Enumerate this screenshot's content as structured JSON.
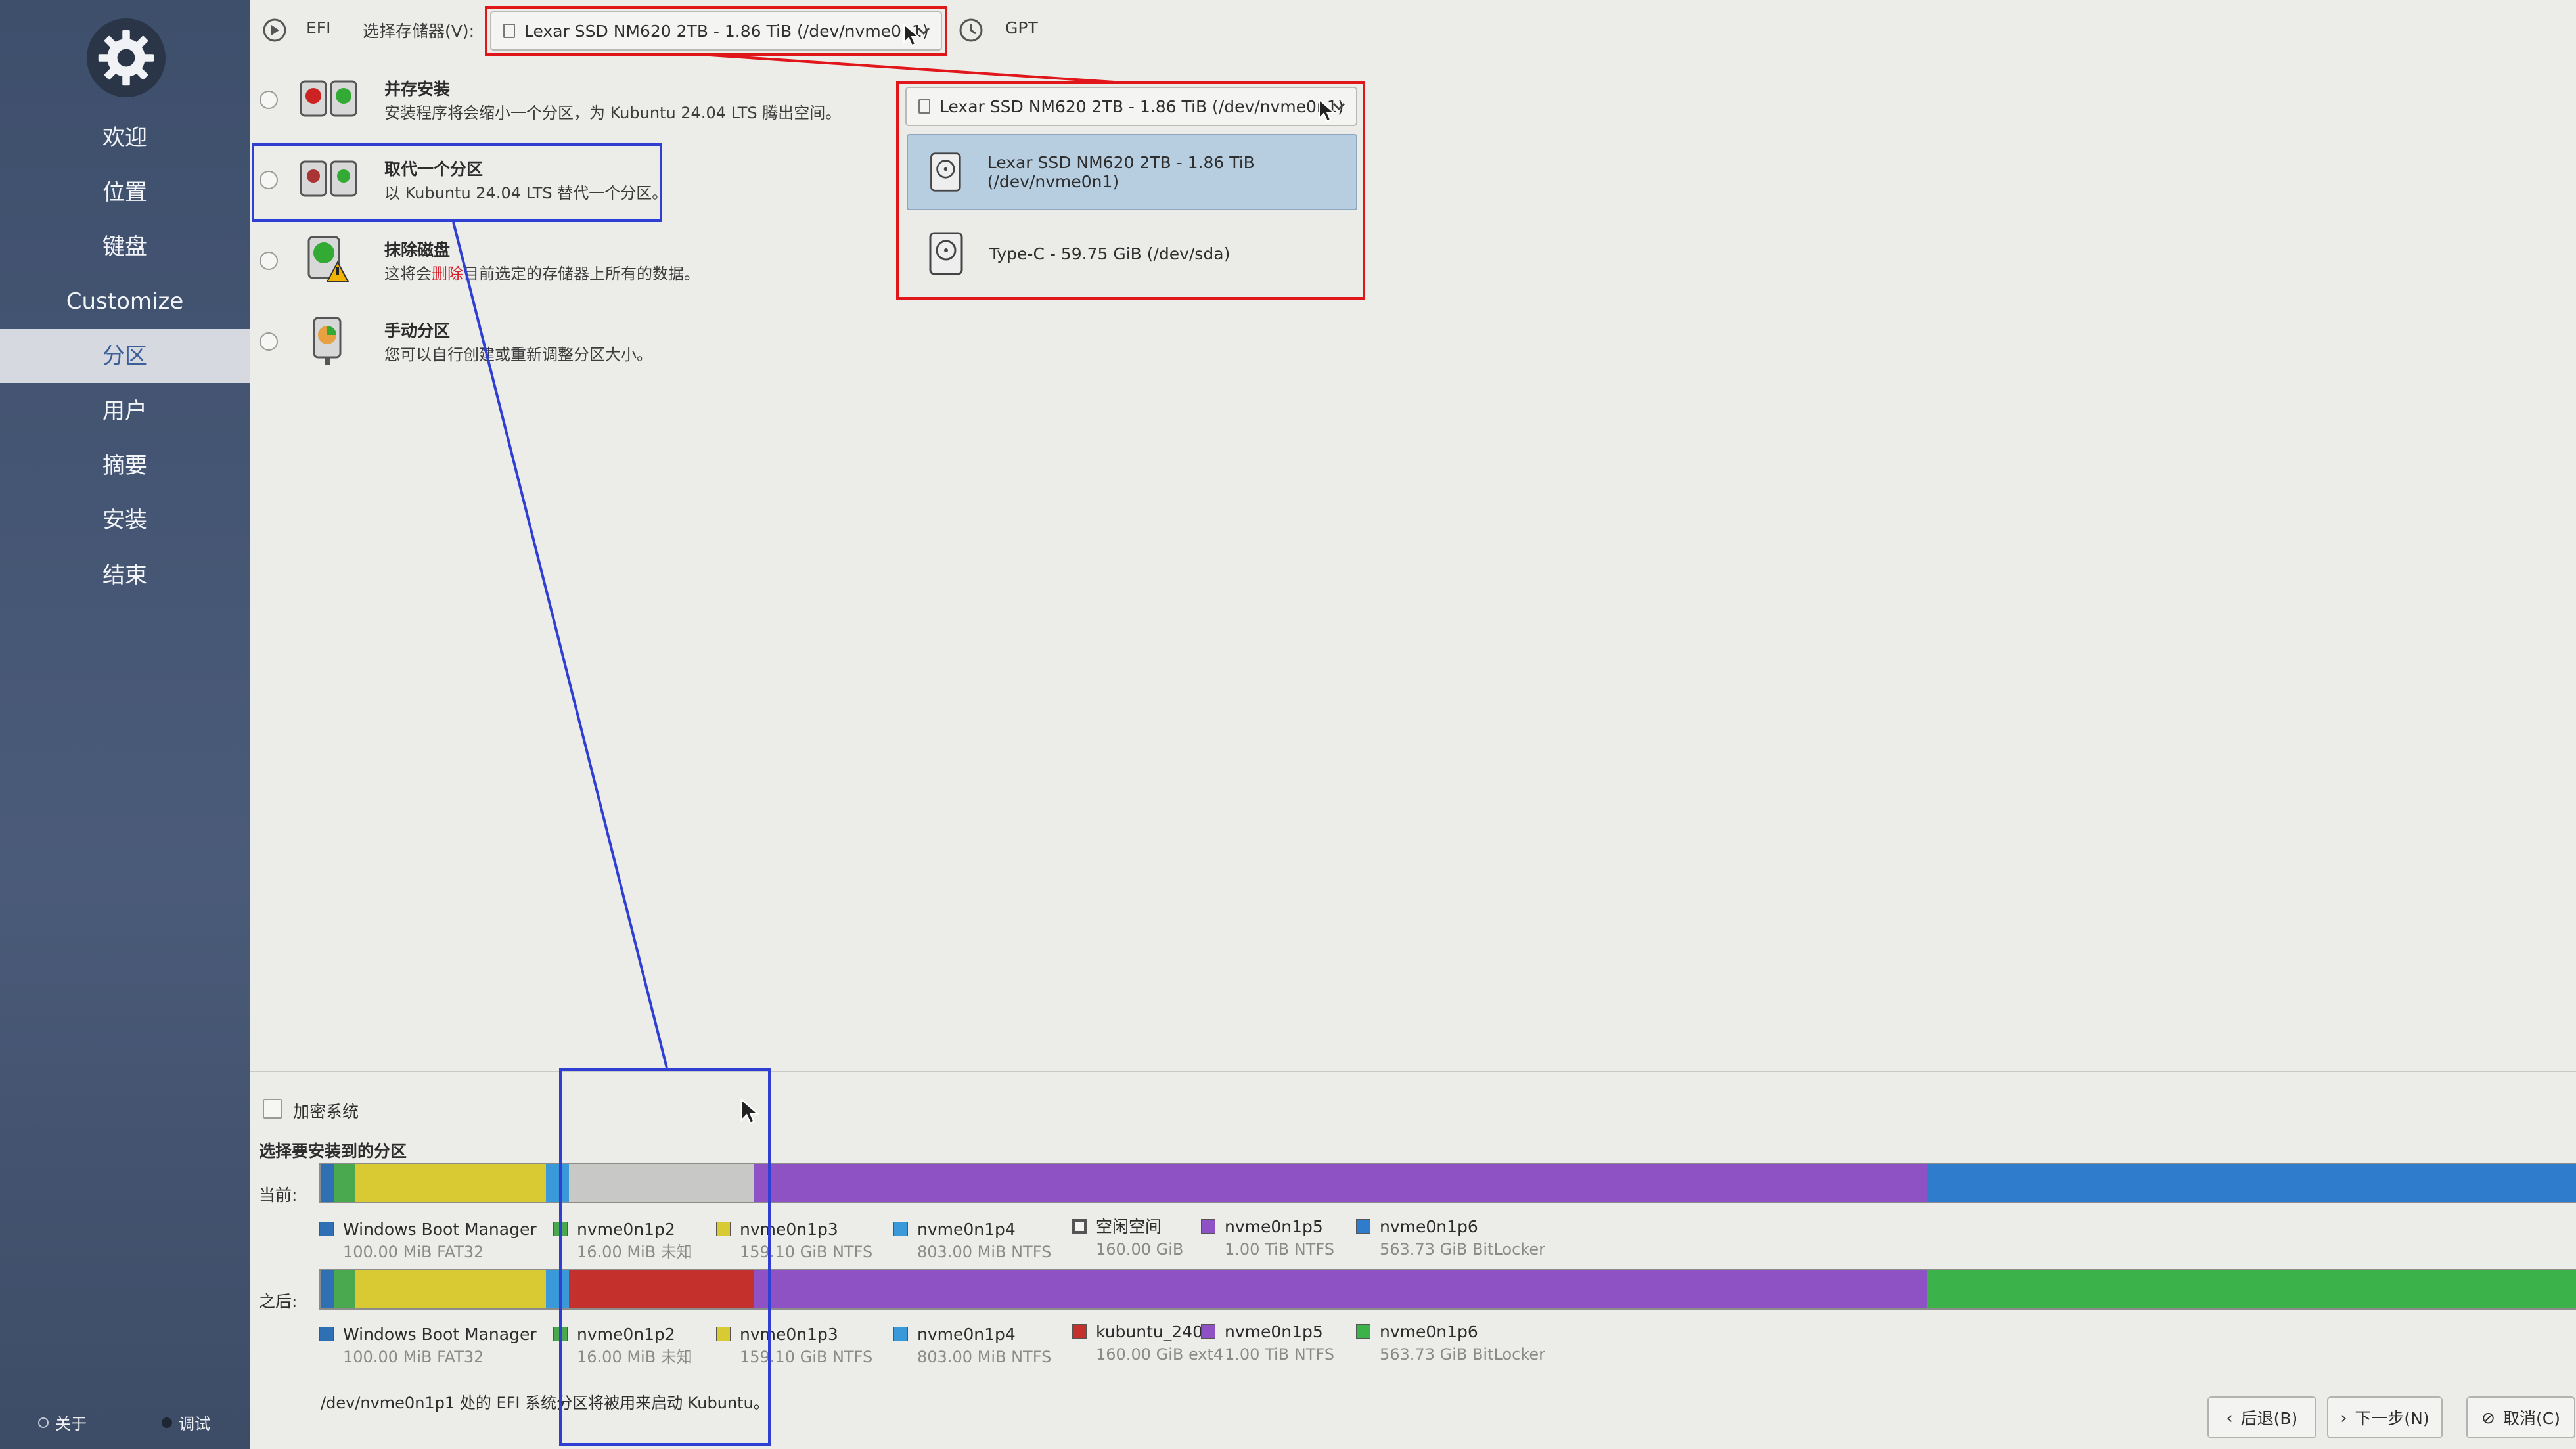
{
  "sidebar": {
    "items": [
      {
        "label": "欢迎"
      },
      {
        "label": "位置"
      },
      {
        "label": "键盘"
      },
      {
        "label": "Customize"
      },
      {
        "label": "分区"
      },
      {
        "label": "用户"
      },
      {
        "label": "摘要"
      },
      {
        "label": "安装"
      },
      {
        "label": "结束"
      }
    ],
    "active_index": 4,
    "footer": {
      "about": "关于",
      "debug": "调试"
    }
  },
  "topbar": {
    "efi_label": "EFI",
    "storage_label": "选择存储器(V):",
    "storage_value": "Lexar SSD NM620 2TB - 1.86 TiB (/dev/nvme0n1)",
    "gpt_label": "GPT"
  },
  "options": [
    {
      "title": "并存安装",
      "desc": "安装程序将会缩小一个分区，为 Kubuntu 24.04 LTS 腾出空间。"
    },
    {
      "title": "取代一个分区",
      "desc": "以 Kubuntu 24.04 LTS 替代一个分区。"
    },
    {
      "title": "抹除磁盘",
      "desc_pre": "这将会",
      "desc_warn": "删除",
      "desc_post": "目前选定的存储器上所有的数据。"
    },
    {
      "title": "手动分区",
      "desc": "您可以自行创建或重新调整分区大小。"
    }
  ],
  "dropdown": {
    "value": "Lexar SSD NM620 2TB - 1.86 TiB (/dev/nvme0n1)",
    "items": [
      {
        "label": "Lexar SSD NM620 2TB - 1.86 TiB (/dev/nvme0n1)",
        "selected": true
      },
      {
        "label": "Type-C - 59.75 GiB (/dev/sda)",
        "selected": false
      }
    ]
  },
  "bottom": {
    "encrypt_label": "加密系统",
    "choose_label": "选择要安装到的分区",
    "current_label": "当前:",
    "after_label": "之后:",
    "note": "/dev/nvme0n1p1 处的 EFI 系统分区将被用来启动 Kubuntu。"
  },
  "current_partitions": [
    {
      "name": "Windows Boot Manager",
      "info": "100.00 MiB  FAT32",
      "color": "#2f6fb3",
      "share": 0.6
    },
    {
      "name": "nvme0n1p2",
      "info": "16.00 MiB  未知",
      "color": "#4aa84f",
      "share": 0.9
    },
    {
      "name": "nvme0n1p3",
      "info": "159.10 GiB  NTFS",
      "color": "#d9c933",
      "share": 8.3
    },
    {
      "name": "nvme0n1p4",
      "info": "803.00 MiB  NTFS",
      "color": "#3a9ad9",
      "share": 1.0
    },
    {
      "name": "空闲空间",
      "info": "160.00 GiB",
      "color": "#c8c8c6",
      "share": 8.0,
      "hollow": true
    },
    {
      "name": "nvme0n1p5",
      "info": "1.00 TiB  NTFS",
      "color": "#8e52c4",
      "share": 51.0
    },
    {
      "name": "nvme0n1p6",
      "info": "563.73 GiB  BitLocker",
      "color": "#2f7ccc",
      "share": 28.2
    }
  ],
  "after_partitions": [
    {
      "name": "Windows Boot Manager",
      "info": "100.00 MiB  FAT32",
      "color": "#2f6fb3",
      "share": 0.6
    },
    {
      "name": "nvme0n1p2",
      "info": "16.00 MiB  未知",
      "color": "#4aa84f",
      "share": 0.9
    },
    {
      "name": "nvme0n1p3",
      "info": "159.10 GiB  NTFS",
      "color": "#d9c933",
      "share": 8.3
    },
    {
      "name": "nvme0n1p4",
      "info": "803.00 MiB  NTFS",
      "color": "#3a9ad9",
      "share": 1.0
    },
    {
      "name": "kubuntu_2404",
      "info": "160.00 GiB  ext4",
      "color": "#c4302b",
      "share": 8.0
    },
    {
      "name": "nvme0n1p5",
      "info": "1.00 TiB  NTFS",
      "color": "#8e52c4",
      "share": 51.0
    },
    {
      "name": "nvme0n1p6",
      "info": "563.73 GiB  BitLocker",
      "color": "#3bb34a",
      "share": 28.2
    }
  ],
  "buttons": {
    "back": "后退(B)",
    "next": "下一步(N)",
    "cancel": "取消(C)"
  }
}
